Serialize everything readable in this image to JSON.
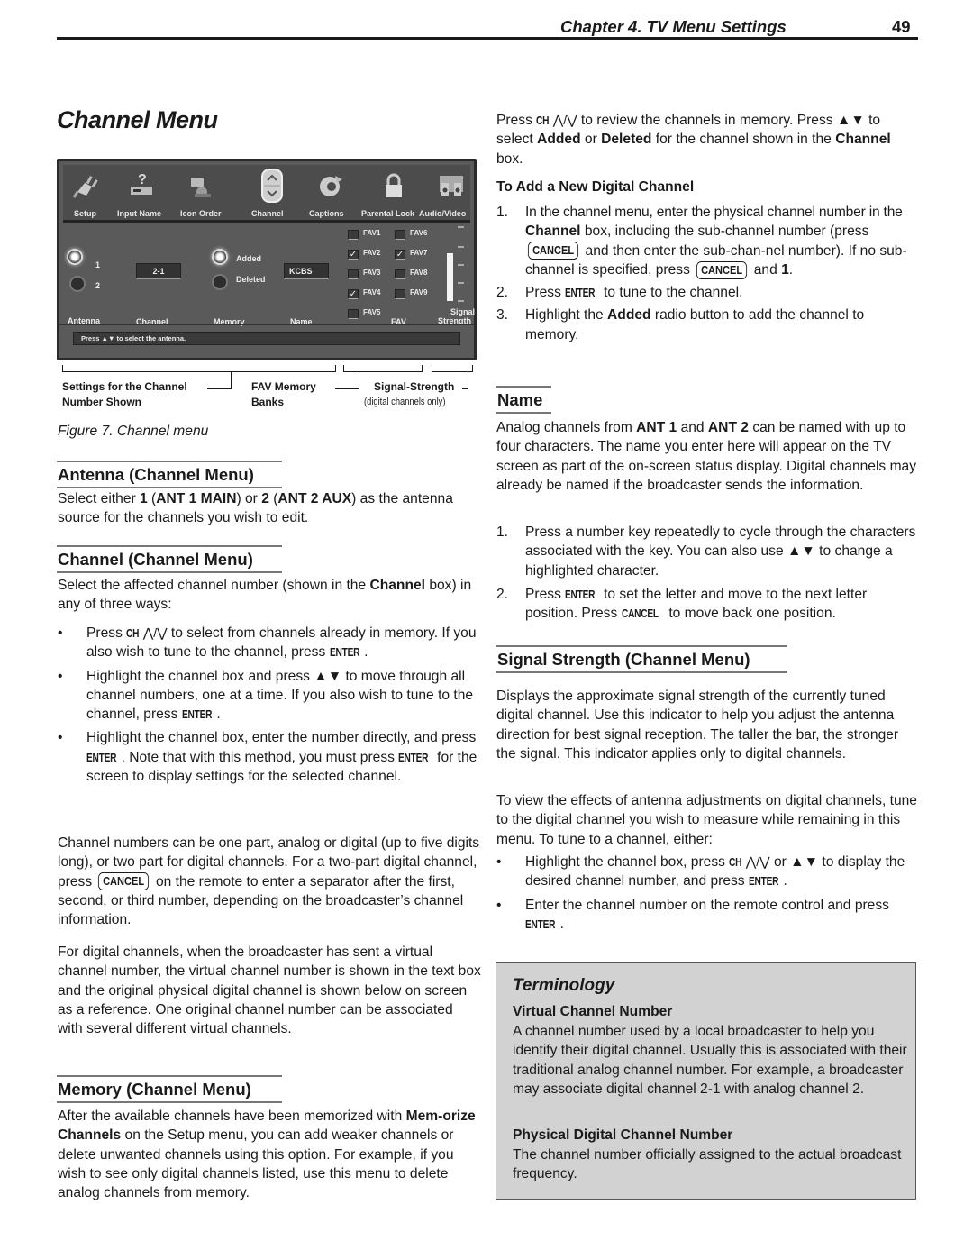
{
  "header": {
    "chapter": "Chapter 4. TV Menu Settings",
    "page_number": "49"
  },
  "page_title": "Channel Menu",
  "figure": {
    "top_icons": [
      {
        "label": "Setup",
        "icon": "plug-icon"
      },
      {
        "label": "Input Name",
        "icon": "input-device-icon"
      },
      {
        "label": "Icon Order",
        "icon": "camcorder-icon"
      },
      {
        "label": "Channel",
        "icon": "channel-updown-icon"
      },
      {
        "label": "Captions",
        "icon": "captions-icon"
      },
      {
        "label": "Parental Lock",
        "icon": "padlock-icon"
      },
      {
        "label": "Audio/Video",
        "icon": "speakers-icon"
      }
    ],
    "antenna": {
      "label": "Antenna",
      "options": [
        "1",
        "2"
      ],
      "selected": "1"
    },
    "channel": {
      "label": "Channel",
      "value": "2-1"
    },
    "memory": {
      "label": "Memory",
      "options": [
        "Added",
        "Deleted"
      ],
      "selected": "Added"
    },
    "name": {
      "label": "Name",
      "value": "KCBS"
    },
    "fav": {
      "label": "FAV",
      "items": [
        {
          "label": "FAV1",
          "checked": false
        },
        {
          "label": "FAV2",
          "checked": true
        },
        {
          "label": "FAV3",
          "checked": false
        },
        {
          "label": "FAV4",
          "checked": true
        },
        {
          "label": "FAV5",
          "checked": false
        },
        {
          "label": "FAV6",
          "checked": false
        },
        {
          "label": "FAV7",
          "checked": true
        },
        {
          "label": "FAV8",
          "checked": false
        },
        {
          "label": "FAV9",
          "checked": false
        }
      ]
    },
    "signal_strength": {
      "label_line1": "Signal",
      "label_line2": "Strength",
      "level_fraction": 0.75
    },
    "status_text": "Press ▲▼ to select the antenna.",
    "callouts": {
      "settings_line1": "Settings for the Channel",
      "settings_line2": "Number Shown",
      "fav_line1": "FAV Memory",
      "fav_line2": "Banks",
      "signal_line1": "Signal-Strength",
      "signal_line2": "(digital channels only)"
    },
    "caption": "Figure 7.  Channel menu"
  },
  "left": {
    "antenna_heading": "Antenna (Channel Menu)",
    "antenna_text": {
      "t1": "Select either ",
      "b1": "1",
      "t2": " (",
      "b2": "ANT 1 MAIN",
      "t3": ") or ",
      "b3": "2",
      "t4": " (",
      "b4": "ANT 2 AUX",
      "t5": ") as the antenna source for the channels you wish to edit."
    },
    "channel_heading": "Channel (Channel Menu)",
    "channel_intro": {
      "t1": "Select the affected channel number (shown in the ",
      "b1": "Channel",
      "t2": " box) in any of three ways:"
    },
    "channel_bullets": {
      "b1_pre": "Press ",
      "b1_ch": "CH",
      "b1_post": " to select from channels already in memory.  If you also wish to tune to the channel, press ",
      "b1_enter": "ENTER",
      "b1_end": ".",
      "b2_pre": "Highlight the channel box and press ▲▼ to move through all channel numbers, one at a time.  If you also wish to tune to the channel, press ",
      "b2_enter": "ENTER",
      "b2_end": ".",
      "b3_pre": "Highlight the channel box, enter the number directly, and press ",
      "b3_enter1": "ENTER",
      "b3_mid": ".  Note that with this method, you must press ",
      "b3_enter2": "ENTER",
      "b3_end": " for the screen to display settings for the selected channel."
    },
    "channel_numbers_text": {
      "t1": "Channel numbers can be one part, analog or digital (up to five digits long), or two part for digital channels.  For a two-part digital channel, press ",
      "key": "CANCEL",
      "t2": " on the remote to enter a separator after the first, second, or third number, depending on the broadcaster’s channel information."
    },
    "digital_text": "For digital channels, when the broadcaster has sent a virtual channel number, the virtual channel number is shown in the text box and the original physical digital channel is shown below on screen as a reference.  One original channel number can be associated with several different virtual channels.",
    "memory_heading": "Memory (Channel Menu)",
    "memory_text": {
      "t1": "After the available channels have been memorized with ",
      "b1": "Mem-orize Channels",
      "t2": " on the Setup menu, you can add weaker channels or delete unwanted channels using this option.  For example, if you wish to see only digital channels listed, use this menu to delete analog channels from memory."
    }
  },
  "right": {
    "intro": {
      "t1": "Press ",
      "ch": "CH",
      "t2": " to review the channels in memory.  Press ▲▼ to select ",
      "b1": "Added",
      "t3": " or ",
      "b2": "Deleted",
      "t4": " for the channel shown in the ",
      "b3": "Channel",
      "t5": " box."
    },
    "add_digital_heading": "To Add a New Digital Channel",
    "add_steps": {
      "s1_a": "In the channel menu, enter the physical channel number in the ",
      "s1_b": "Channel",
      "s1_c": " box, including the sub-channel number (press ",
      "s1_key1": "CANCEL",
      "s1_d": " and then enter the sub-chan-nel number).  If no sub-channel is specified, press ",
      "s1_key2": "CANCEL",
      "s1_e": " and ",
      "s1_f": "1",
      "s1_g": ".",
      "s2_a": "Press ",
      "s2_enter": "ENTER",
      "s2_b": " to tune to the channel.",
      "s3_a": "Highlight the ",
      "s3_b": "Added",
      "s3_c": " radio button to add the channel to memory."
    },
    "name_heading": "Name",
    "name_text": {
      "t1": "Analog channels from ",
      "b1": "ANT 1",
      "t2": " and ",
      "b2": "ANT 2",
      "t3": " can be named with up to four characters.  The name you enter here will appear on the TV screen as part of the on-screen status display.  Digital channels may already be named if the broadcaster sends the information."
    },
    "name_steps": {
      "s1": "Press a number key repeatedly to cycle through the characters associated with the key.  You can also use ▲▼ to change a highlighted character.",
      "s2_a": "Press ",
      "s2_enter": "ENTER",
      "s2_b": " to set the letter and move to the next letter position.  Press ",
      "s2_cancel": "CANCEL",
      "s2_c": " to move back one position."
    },
    "signal_heading": "Signal Strength (Channel Menu)",
    "signal_text1": "Displays the approximate signal strength of the currently tuned digital channel.  Use this indicator to help you adjust the antenna direction for best signal reception.  The taller the bar, the stronger the signal.  This indicator applies only to digital channels.",
    "signal_text2": "To view the effects of antenna adjustments on digital channels, tune to the digital channel you wish to measure while remaining in this menu.  To tune to a channel, either:",
    "signal_bullets": {
      "b1_a": "Highlight the channel box, press ",
      "b1_ch": "CH",
      "b1_b": " or  ▲▼ to display the desired channel number, and press ",
      "b1_enter": "ENTER",
      "b1_c": ".",
      "b2_a": "Enter the channel number on the remote control and press ",
      "b2_enter": "ENTER",
      "b2_b": "."
    },
    "terminology": {
      "title": "Terminology",
      "term1": "Virtual Channel Number",
      "def1": "A channel number used by a local broadcaster to help you identify their digital channel.  Usually this is associated with their traditional analog channel number.  For example, a broadcaster may associate digital channel 2-1 with analog channel 2.",
      "term2": "Physical Digital Channel Number",
      "def2": "The channel number officially assigned to the actual broadcast frequency."
    }
  }
}
